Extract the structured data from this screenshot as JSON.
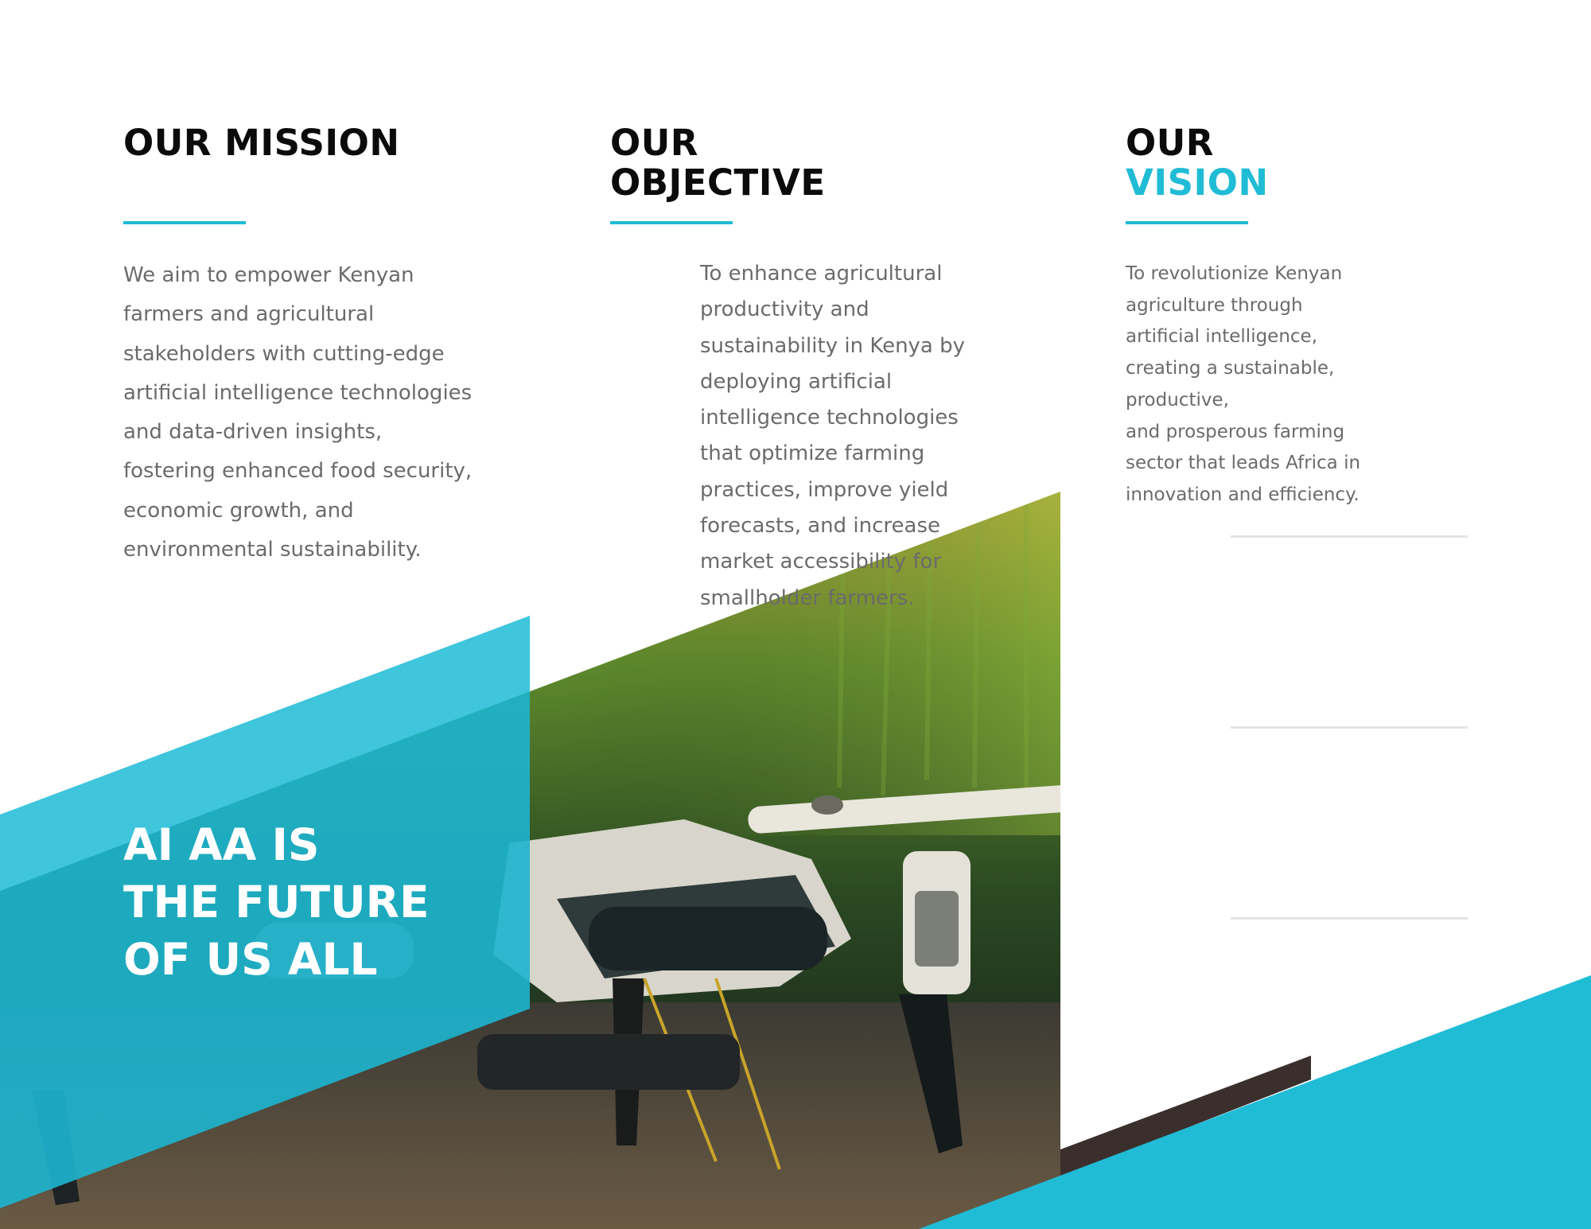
{
  "mission": {
    "heading": "OUR MISSION",
    "text": "We aim to empower Kenyan farmers and agricultural stakeholders with cutting-edge artificial intelligence technologies and data-driven insights, fostering enhanced food security, economic growth, and environmental sustainability."
  },
  "objective": {
    "heading_line1": "OUR",
    "heading_line2": "OBJECTIVE",
    "text": "To enhance agricultural productivity and sustainability in Kenya by deploying artificial intelligence technologies that optimize farming practices, improve yield forecasts, and increase market accessibility for smallholder farmers."
  },
  "vision": {
    "heading_line1": "OUR",
    "heading_line2": "VISION",
    "text_lines": [
      "To revolutionize Kenyan",
      "agriculture through",
      "artificial intelligence,",
      "creating a sustainable,",
      "productive,",
      "and prosperous farming",
      "sector that leads Africa in",
      "innovation and efficiency."
    ]
  },
  "hero": {
    "lines": [
      "AI AA IS",
      "THE FUTURE",
      "OF US ALL"
    ]
  },
  "colors": {
    "accent": "#20bcd6",
    "heading": "#0b0b0b",
    "body_text": "#6b6b6b",
    "dark_stripe": "#3a2f2d"
  }
}
